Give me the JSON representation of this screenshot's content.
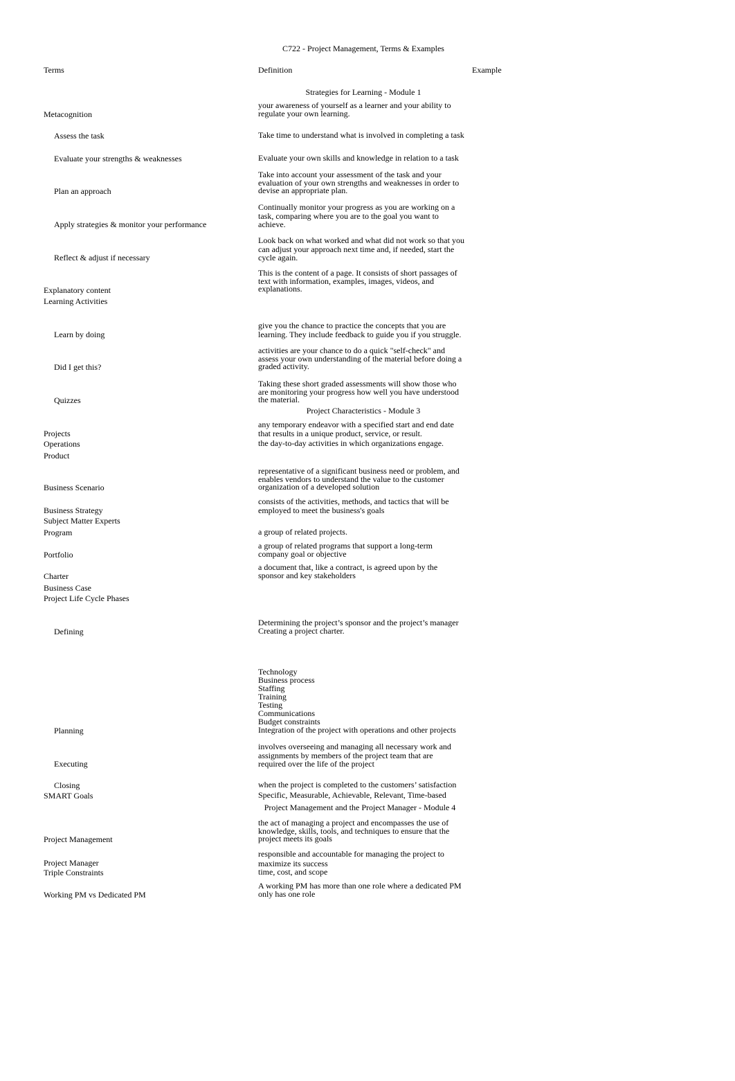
{
  "document": {
    "title": "C722 - Project Management, Terms & Examples",
    "headers": {
      "terms": "Terms",
      "definition": "Definition",
      "example": "Example"
    },
    "sections": [
      {
        "heading": "Strategies for Learning - Module 1",
        "rows": [
          {
            "term": "Metacognition",
            "definition": "your awareness of yourself as a learner and your ability to\nregulate your own learning."
          },
          {
            "term": "Assess the task",
            "definition": "Take time to understand what is involved in completing a task"
          },
          {
            "term": "Evaluate your strengths & weaknesses",
            "definition": "Evaluate your own skills and knowledge in relation to a task"
          },
          {
            "term": "Plan an approach",
            "definition": "Take into account your assessment of the task and your\nevaluation of your own strengths and weaknesses in order to\ndevise an appropriate plan."
          },
          {
            "term": "Apply strategies & monitor your performance",
            "definition": "Continually monitor your progress as you are working on a\ntask, comparing where you are to the goal you want to\nachieve."
          },
          {
            "term": "Reflect & adjust if necessary",
            "definition": "Look back on what worked and what did not work so that you\ncan adjust your approach next time and, if needed, start the\ncycle again."
          },
          {
            "term": "Explanatory content",
            "definition": "This is the content of a page. It consists of short passages of\ntext with information, examples, images, videos, and\nexplanations."
          },
          {
            "term": "Learning Activities",
            "definition": ""
          },
          {
            "term": "Learn by doing",
            "definition": "give you the chance to practice the concepts that you are\nlearning. They include feedback to guide you if you struggle."
          },
          {
            "term": "Did I get this?",
            "definition": " activities are your chance to do a quick \"self-check\" and\nassess your own understanding of the material before doing a\ngraded activity."
          },
          {
            "term": "Quizzes",
            "definition": "Taking these short graded assessments will show those who\nare monitoring your progress how well you have understood\nthe material."
          }
        ]
      },
      {
        "heading": "Project Characteristics - Module 3",
        "rows": [
          {
            "term": "Projects",
            "definition": " any temporary endeavor with a specified start and end date\nthat results in a unique product, service, or result."
          },
          {
            "term": "Operations",
            "definition": "the day-to-day activities in which organizations engage."
          },
          {
            "term": "Product",
            "definition": ""
          },
          {
            "term": "Business Scenario",
            "definition": "representative of a significant business need or problem, and\nenables vendors to understand the value to the customer\norganization of a developed solution"
          },
          {
            "term": "Business Strategy",
            "definition": "consists of the activities, methods, and tactics that will be\nemployed to meet the business's goals"
          },
          {
            "term": "Subject Matter Experts",
            "definition": ""
          },
          {
            "term": "Program",
            "definition": "a group of related projects."
          },
          {
            "term": "Portfolio",
            "definition": " a group of related programs that support a long-term\ncompany goal or objective"
          },
          {
            "term": "Charter",
            "definition": "a document that, like a contract, is agreed upon by the\nsponsor and key stakeholders"
          },
          {
            "term": "Business Case",
            "definition": ""
          },
          {
            "term": "Project Life Cycle Phases",
            "definition": ""
          },
          {
            "term": "Defining",
            "definition": "Determining the project’s sponsor and the project’s manager\nCreating a project charter."
          },
          {
            "term": "Planning",
            "definition": "Technology\nBusiness process\nStaffing\nTraining\nTesting\nCommunications\nBudget constraints\nIntegration of the project with operations and other projects"
          },
          {
            "term": "Executing",
            "definition": "involves overseeing and managing all necessary work and\nassignments by members of the project team that are\nrequired over the life of the project"
          },
          {
            "term": "Closing",
            "definition": "when the project is completed to the customers’ satisfaction"
          },
          {
            "term": "SMART Goals",
            "definition": "Specific, Measurable, Achievable, Relevant, Time-based"
          }
        ]
      },
      {
        "heading": "Project Management and the Project Manager - Module 4",
        "rows": [
          {
            "term": "Project Management",
            "definition": "the act of managing a project and encompasses the use of\nknowledge, skills, tools, and techniques to ensure that the\nproject meets its goals"
          },
          {
            "term": "Project Manager",
            "definition": " responsible and accountable for managing the project to\nmaximize its success"
          },
          {
            "term": "Triple Constraints",
            "definition": "time, cost, and scope"
          },
          {
            "term": "Working PM vs Dedicated PM",
            "definition": "A working PM has more than one role where a dedicated PM\nonly has one role"
          }
        ]
      }
    ]
  }
}
